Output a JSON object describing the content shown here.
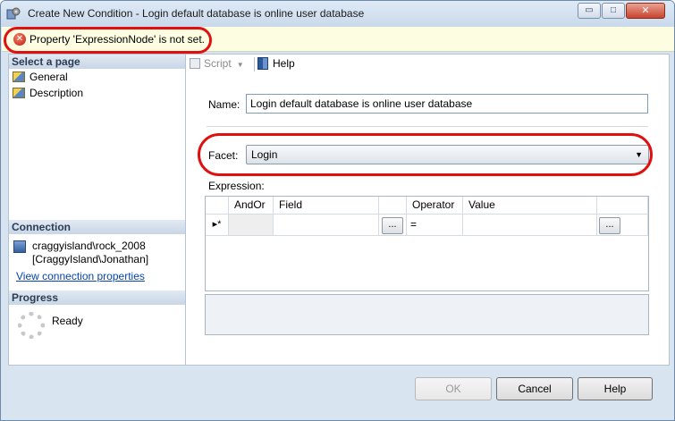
{
  "window": {
    "title": "Create New Condition - Login default database is online user database",
    "controls": {
      "minimize": "▭",
      "maximize": "□",
      "close": "✕"
    }
  },
  "error": {
    "icon": "error-x-icon",
    "glyph": "✕",
    "message": "Property 'ExpressionNode' is not set."
  },
  "sidebar": {
    "select_page_header": "Select a page",
    "pages": [
      {
        "label": "General",
        "icon": "page-icon"
      },
      {
        "label": "Description",
        "icon": "page-icon"
      }
    ],
    "connection_header": "Connection",
    "connection": {
      "server": "craggyisland\\rock_2008",
      "user": "[CraggyIsland\\Jonathan]",
      "link": "View connection properties"
    },
    "progress_header": "Progress",
    "progress_status": "Ready"
  },
  "toolbar": {
    "script_label": "Script",
    "script_caret": "▼",
    "help_label": "Help"
  },
  "form": {
    "name_label": "Name:",
    "name_value": "Login default database is online user database",
    "facet_label": "Facet:",
    "facet_value": "Login",
    "facet_arrow": "▼",
    "expression_label": "Expression:"
  },
  "expression_grid": {
    "columns": [
      "",
      "AndOr",
      "Field",
      "",
      "Operator",
      "Value",
      ""
    ],
    "new_row": {
      "marker": "▸*",
      "andor": "",
      "field": "",
      "field_button": "...",
      "operator": "=",
      "value": "",
      "value_button": "..."
    }
  },
  "footer": {
    "ok": "OK",
    "cancel": "Cancel",
    "help": "Help"
  },
  "colors": {
    "annotation_red": "#e01010",
    "link": "#0645ad",
    "error_bar": "#fdfde1"
  }
}
